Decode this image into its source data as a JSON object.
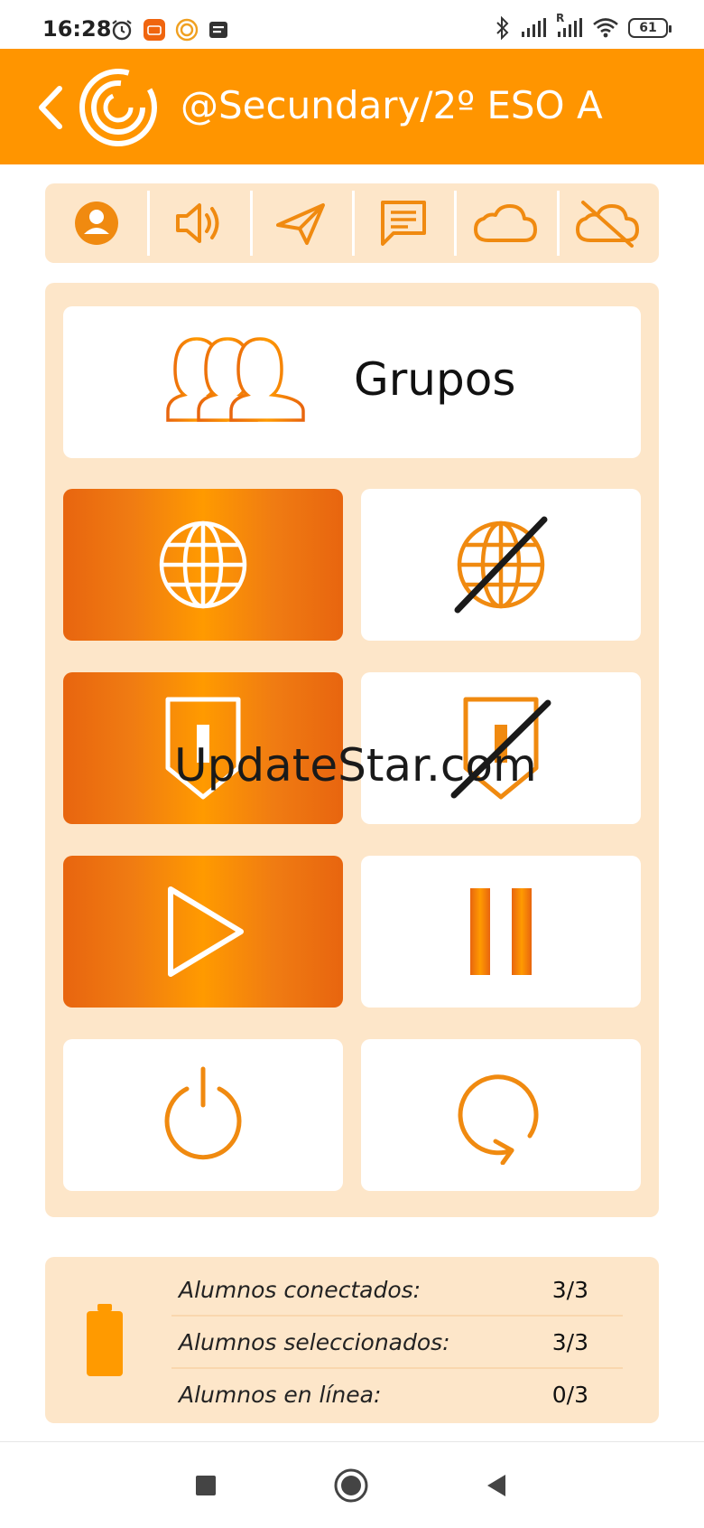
{
  "status_bar": {
    "time": "16:28",
    "left_icons": [
      "alarm-icon",
      "mi-app-icon",
      "app-notification-icon",
      "message-icon"
    ],
    "right_icons": [
      "bluetooth-icon",
      "signal-icon",
      "signal-roaming-icon",
      "wifi-icon"
    ],
    "roaming_label": "R",
    "battery_level": "61"
  },
  "app_bar": {
    "back_icon": "chevron-left-icon",
    "logo_icon": "app-logo-icon",
    "title": "@Secundary/2º ESO A"
  },
  "toolbar": {
    "items": [
      {
        "icon": "user-icon"
      },
      {
        "icon": "volume-icon"
      },
      {
        "icon": "send-icon"
      },
      {
        "icon": "message-icon"
      },
      {
        "icon": "cloud-icon"
      },
      {
        "icon": "cloud-off-icon"
      }
    ]
  },
  "panel": {
    "grupos": {
      "icon": "users-group-icon",
      "label": "Grupos"
    },
    "tiles": [
      {
        "icon": "globe-icon",
        "state": "active"
      },
      {
        "icon": "globe-off-icon",
        "state": "inactive"
      },
      {
        "icon": "shield-lock-icon",
        "state": "active"
      },
      {
        "icon": "shield-lock-off-icon",
        "state": "inactive"
      },
      {
        "icon": "play-icon",
        "state": "active"
      },
      {
        "icon": "pause-icon",
        "state": "inactive"
      },
      {
        "icon": "power-icon",
        "state": "inactive"
      },
      {
        "icon": "refresh-icon",
        "state": "inactive"
      }
    ]
  },
  "watermark": "UpdateStar.com",
  "stats": {
    "battery_icon": "battery-icon",
    "rows": [
      {
        "label": "Alumnos conectados:",
        "value": "3/3"
      },
      {
        "label": "Alumnos seleccionados:",
        "value": "3/3"
      },
      {
        "label": "Alumnos en línea:",
        "value": "0/3"
      }
    ]
  },
  "nav_bar": {
    "items": [
      "recents-square-icon",
      "home-circle-icon",
      "back-triangle-icon"
    ]
  },
  "colors": {
    "accent": "#ff9500",
    "accent_dark": "#e8650f",
    "panel_bg": "#fde6c9",
    "icon_orange": "#f08a10"
  }
}
